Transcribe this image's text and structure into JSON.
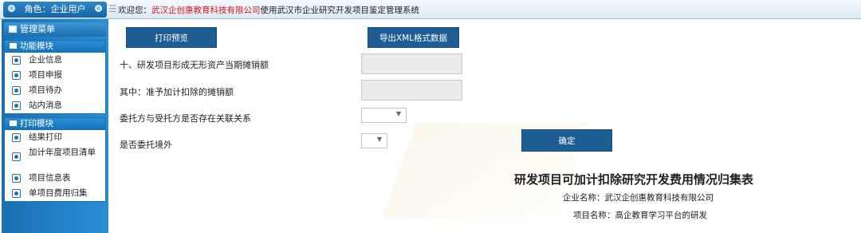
{
  "topbar": {
    "role": "角色：企业用户",
    "welcome_prefix": "欢迎您：",
    "company": "武汉企创惠教育科技有限公司",
    "welcome_suffix": "使用武汉市企业研究开发项目鉴定管理系统"
  },
  "sidebar": {
    "title": "管理菜单",
    "modules": [
      {
        "name": "功能模块",
        "items": [
          "企业信息",
          "项目申报",
          "项目待办",
          "站内消息"
        ]
      },
      {
        "name": "打印模块",
        "items": [
          "结果打印",
          "加计年度项目清单",
          "项目信息表",
          "单项目费用归集"
        ]
      }
    ]
  },
  "toolbar": {
    "print_preview": "打印预览",
    "export_xml": "导出XML格式数据"
  },
  "form": {
    "amortization_label": "十、研发项目形成无形资产当期摊销额",
    "deductible_label": "其中：准予加计扣除的摊销额",
    "related_party_label": "委托方与受托方是否存在关联关系",
    "overseas_label": "是否委托境外",
    "confirm": "确定"
  },
  "summary": {
    "title": "研发项目可加计扣除研究开发费用情况归集表",
    "company_line": "企业名称：武汉企创惠教育科技有限公司",
    "project_line": "项目名称：高企教育学习平台的研发"
  },
  "colors": {
    "primary_blue": "#1d5d94",
    "sidebar_blue": "#1b6fb0",
    "company_red": "#d21a1a"
  }
}
